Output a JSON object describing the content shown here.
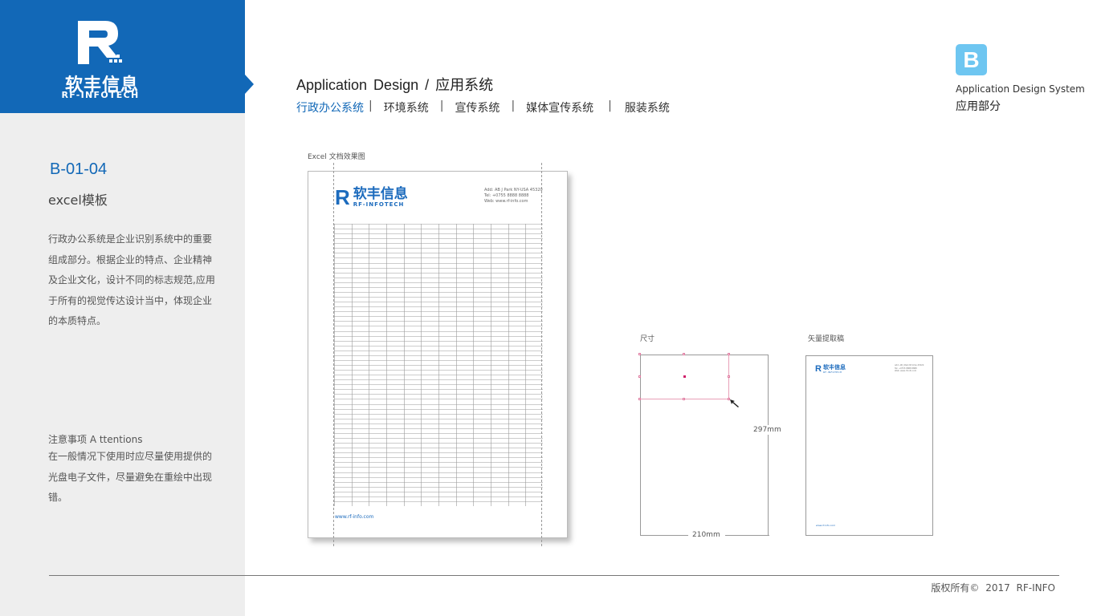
{
  "brand": {
    "name_cn": "软丰信息",
    "name_en": "RF-INFOTECH",
    "color": "#1268b7"
  },
  "sidebar": {
    "code": "B-01-04",
    "subtitle": "excel模板",
    "description": "行政办公系统是企业识别系统中的重要组成部分。根据企业的特点、企业精神及企业文化，设计不同的标志规范,应用于所有的视觉传达设计当中，体现企业的本质特点。",
    "attention_title": "注意事项 A ttentions",
    "attention_text": "在一般情况下使用时应尽量使用提供的光盘电子文件，尽量避免在重绘中出现错。"
  },
  "header": {
    "title": "Application  Design  /  应用系统",
    "nav": [
      {
        "label": "行政办公系统",
        "active": true
      },
      {
        "label": "环境系统",
        "active": false
      },
      {
        "label": "宣传系统",
        "active": false
      },
      {
        "label": "媒体宣传系统",
        "active": false
      },
      {
        "label": "服装系统",
        "active": false
      }
    ],
    "nav_separator": "|"
  },
  "section_badge": {
    "letter": "B",
    "title_en": "Application  Design  System",
    "title_cn": "应用部分",
    "color": "#6ec6f1"
  },
  "preview": {
    "label": "Excel 文档效果图",
    "logo_letter": "R",
    "contact": [
      "Add: AB J Park NY-USA 45320",
      "Tel:   +0755 8888 8888",
      "Web: www.rf-info.com"
    ],
    "url": "www.rf-info.com",
    "grid_columns": 12,
    "grid_rows": 58
  },
  "dimensions": {
    "label": "尺寸",
    "width_label": "210mm",
    "height_label": "297mm"
  },
  "vector": {
    "label": "矢量提取稿",
    "logo_letter": "R",
    "contact": [
      "Add: AB J Park NY-USA 45320",
      "Tel:   +0755 8888 8888",
      "Web: www.rf-info.com"
    ],
    "url": "www.rf-info.com"
  },
  "footer": {
    "copyright": "版权所有©  2017  RF-INFO"
  }
}
